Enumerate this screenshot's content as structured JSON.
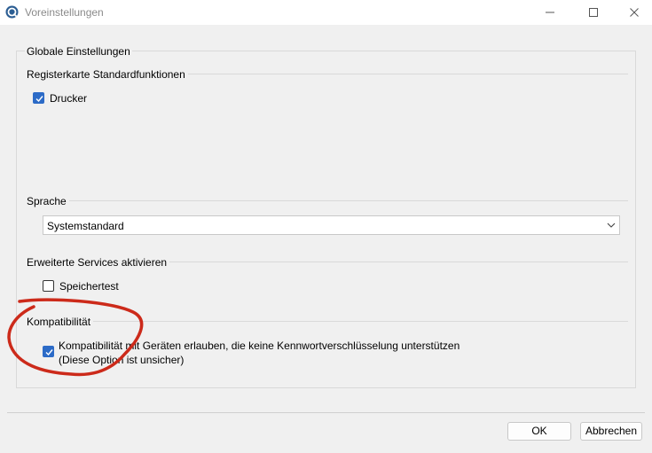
{
  "window": {
    "title": "Voreinstellungen",
    "icons": {
      "app": "app-logo-icon",
      "minimize": "minimize-icon",
      "maximize": "maximize-icon",
      "close": "close-icon"
    }
  },
  "main_group": {
    "label": "Globale Einstellungen"
  },
  "tab_defaults": {
    "label": "Registerkarte Standardfunktionen",
    "printer": {
      "label": "Drucker",
      "checked": true
    }
  },
  "language": {
    "label": "Sprache",
    "selected": "Systemstandard"
  },
  "services": {
    "label": "Erweiterte Services aktivieren",
    "memory_test": {
      "label": "Speichertest",
      "checked": false
    }
  },
  "compatibility": {
    "label": "Kompatibilität",
    "option": {
      "line1": "Kompatibilität mit Geräten erlauben, die keine Kennwortverschlüsselung unterstützen",
      "line2": "(Diese Option ist unsicher)",
      "checked": true
    }
  },
  "buttons": {
    "ok": "OK",
    "cancel": "Abbrechen"
  },
  "colors": {
    "checkbox_accent": "#2c6bc7",
    "annotation": "#cc2a1a"
  }
}
